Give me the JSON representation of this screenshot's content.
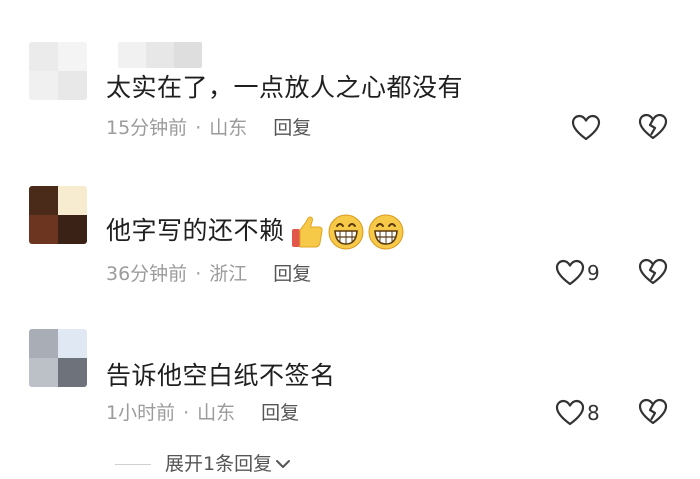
{
  "comments": [
    {
      "text": "太实在了，一点放人之心都没有",
      "time": "15分钟前",
      "separator": "·",
      "location": "山东",
      "reply_label": "回复",
      "likes": ""
    },
    {
      "text": "他字写的还不赖",
      "time": "36分钟前",
      "separator": "·",
      "location": "浙江",
      "reply_label": "回复",
      "likes": "9",
      "emojis": [
        "thumbs-up-icon",
        "grinning-face-icon",
        "grinning-face-icon"
      ]
    },
    {
      "text": "告诉他空白纸不签名",
      "time": "1小时前",
      "separator": "·",
      "location": "山东",
      "reply_label": "回复",
      "likes": "8"
    }
  ],
  "expand_replies": {
    "label": "展开1条回复",
    "icon": "chevron-down-icon"
  },
  "colors": {
    "text": "#1f1f1f",
    "meta": "#9b9b9b",
    "reply": "#555555",
    "icon_stroke": "#333333",
    "emoji_yellow": "#f7c948"
  }
}
